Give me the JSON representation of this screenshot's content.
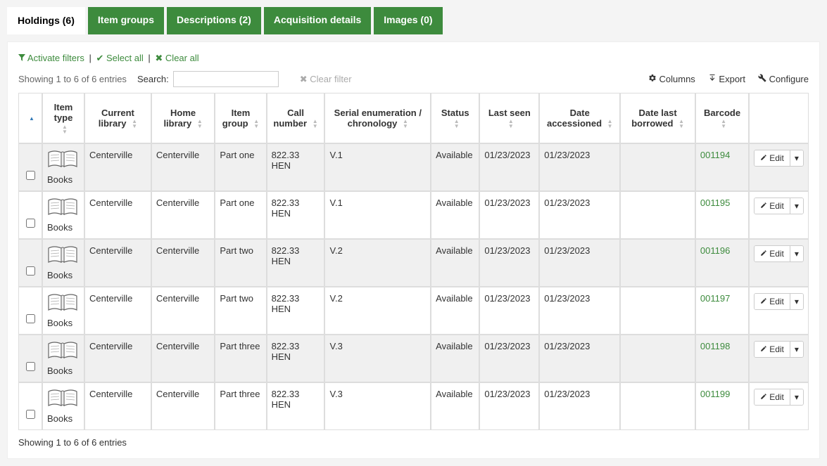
{
  "tabs": [
    {
      "label": "Holdings (6)",
      "active": true
    },
    {
      "label": "Item groups",
      "active": false
    },
    {
      "label": "Descriptions (2)",
      "active": false
    },
    {
      "label": "Acquisition details",
      "active": false
    },
    {
      "label": "Images (0)",
      "active": false
    }
  ],
  "filters": {
    "activate": "Activate filters",
    "select_all": "Select all",
    "clear_all": "Clear all"
  },
  "table_info_top": "Showing 1 to 6 of 6 entries",
  "table_info_bottom": "Showing 1 to 6 of 6 entries",
  "search_label": "Search:",
  "clear_filter": "Clear filter",
  "toolbar": {
    "columns": "Columns",
    "export": "Export",
    "configure": "Configure"
  },
  "columns": {
    "item_type": "Item type",
    "current_library": "Current library",
    "home_library": "Home library",
    "item_group": "Item group",
    "call_number": "Call number",
    "serial_enum": "Serial enumeration / chronology",
    "status": "Status",
    "last_seen": "Last seen",
    "date_accessioned": "Date accessioned",
    "date_last_borrowed": "Date last borrowed",
    "barcode": "Barcode"
  },
  "item_type_name": "Books",
  "edit_label": "Edit",
  "rows": [
    {
      "current_library": "Centerville",
      "home_library": "Centerville",
      "item_group": "Part one",
      "call_number": "822.33 HEN",
      "serial": "V.1",
      "status": "Available",
      "last_seen": "01/23/2023",
      "date_accessioned": "01/23/2023",
      "date_last_borrowed": "",
      "barcode": "001194"
    },
    {
      "current_library": "Centerville",
      "home_library": "Centerville",
      "item_group": "Part one",
      "call_number": "822.33 HEN",
      "serial": "V.1",
      "status": "Available",
      "last_seen": "01/23/2023",
      "date_accessioned": "01/23/2023",
      "date_last_borrowed": "",
      "barcode": "001195"
    },
    {
      "current_library": "Centerville",
      "home_library": "Centerville",
      "item_group": "Part two",
      "call_number": "822.33 HEN",
      "serial": "V.2",
      "status": "Available",
      "last_seen": "01/23/2023",
      "date_accessioned": "01/23/2023",
      "date_last_borrowed": "",
      "barcode": "001196"
    },
    {
      "current_library": "Centerville",
      "home_library": "Centerville",
      "item_group": "Part two",
      "call_number": "822.33 HEN",
      "serial": "V.2",
      "status": "Available",
      "last_seen": "01/23/2023",
      "date_accessioned": "01/23/2023",
      "date_last_borrowed": "",
      "barcode": "001197"
    },
    {
      "current_library": "Centerville",
      "home_library": "Centerville",
      "item_group": "Part three",
      "call_number": "822.33 HEN",
      "serial": "V.3",
      "status": "Available",
      "last_seen": "01/23/2023",
      "date_accessioned": "01/23/2023",
      "date_last_borrowed": "",
      "barcode": "001198"
    },
    {
      "current_library": "Centerville",
      "home_library": "Centerville",
      "item_group": "Part three",
      "call_number": "822.33 HEN",
      "serial": "V.3",
      "status": "Available",
      "last_seen": "01/23/2023",
      "date_accessioned": "01/23/2023",
      "date_last_borrowed": "",
      "barcode": "001199"
    }
  ]
}
